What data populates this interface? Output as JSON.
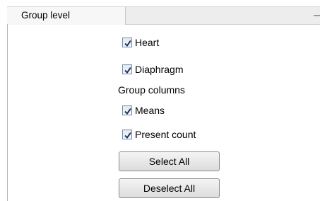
{
  "tab": {
    "label": "Group level"
  },
  "group_level": {
    "items": [
      {
        "label": "Heart",
        "checked": true
      },
      {
        "label": "Diaphragm",
        "checked": true
      }
    ]
  },
  "group_columns": {
    "label": "Group columns",
    "items": [
      {
        "label": "Means",
        "checked": true
      },
      {
        "label": "Present count",
        "checked": true
      }
    ]
  },
  "buttons": {
    "select_all": "Select All",
    "deselect_all": "Deselect All"
  }
}
